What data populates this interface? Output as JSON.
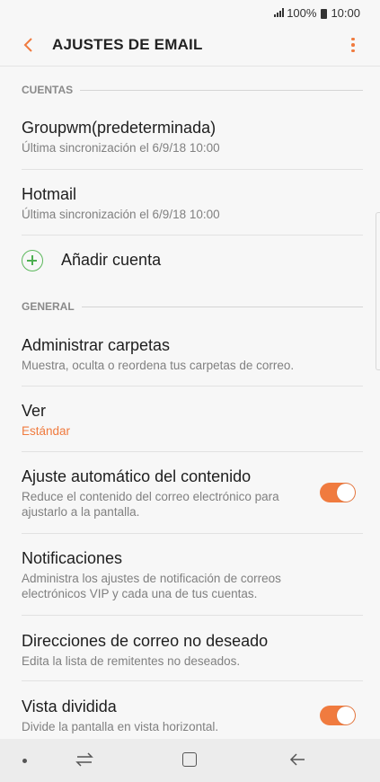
{
  "status_bar": {
    "battery": "100%",
    "time": "10:00"
  },
  "app_bar": {
    "title": "AJUSTES DE EMAIL"
  },
  "sections": {
    "accounts_header": "CUENTAS",
    "general_header": "GENERAL"
  },
  "accounts": [
    {
      "name": "Groupwm(predeterminada)",
      "sync": "Última sincronización el 6/9/18  10:00"
    },
    {
      "name": "Hotmail",
      "sync": "Última sincronización el 6/9/18  10:00"
    }
  ],
  "add_account_label": "Añadir cuenta",
  "general": {
    "folders": {
      "title": "Administrar carpetas",
      "sub": "Muestra, oculta o reordena tus carpetas de correo."
    },
    "view": {
      "title": "Ver",
      "value": "Estándar"
    },
    "autofit": {
      "title": "Ajuste automático del contenido",
      "sub1": "Reduce el contenido del correo electrónico para",
      "sub2": "ajustarlo a la pantalla.",
      "enabled": true
    },
    "notifications": {
      "title": "Notificaciones",
      "sub1": "Administra los ajustes de notificación de correos",
      "sub2": "electrónicos VIP y cada una de tus cuentas."
    },
    "spam": {
      "title": "Direcciones de correo no deseado",
      "sub": "Edita la lista de remitentes no deseados."
    },
    "split": {
      "title": "Vista dividida",
      "sub": "Divide la pantalla en vista horizontal.",
      "enabled": true
    }
  },
  "colors": {
    "accent": "#f07b3f",
    "add_green": "#4caf50"
  }
}
